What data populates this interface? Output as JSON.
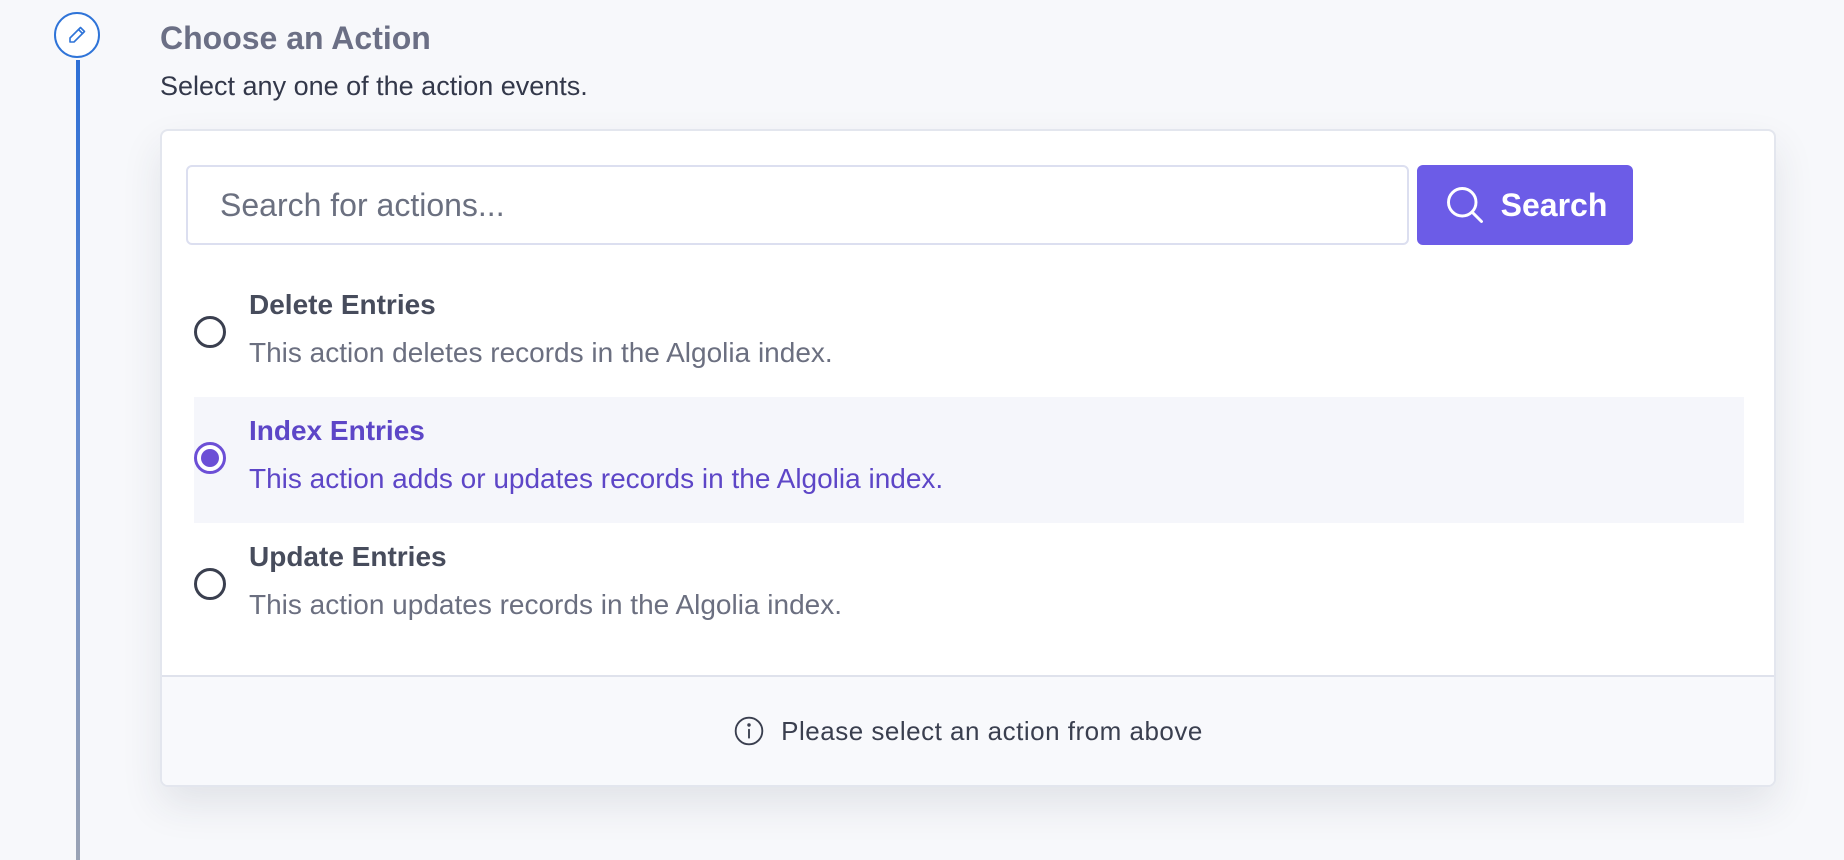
{
  "step": {
    "icon": "pencil-icon"
  },
  "header": {
    "title": "Choose an Action",
    "subtitle": "Select any one of the action events."
  },
  "search": {
    "placeholder": "Search for actions...",
    "value": "",
    "button_label": "Search",
    "button_icon": "search-icon",
    "accent_color": "#6c5ce7"
  },
  "actions": [
    {
      "title": "Delete Entries",
      "description": "This action deletes records in the Algolia index.",
      "selected": false
    },
    {
      "title": "Index Entries",
      "description": "This action adds or updates records in the Algolia index.",
      "selected": true
    },
    {
      "title": "Update Entries",
      "description": "This action updates records in the Algolia index.",
      "selected": false
    }
  ],
  "footer": {
    "icon": "info-icon",
    "message": "Please select an action from above"
  }
}
